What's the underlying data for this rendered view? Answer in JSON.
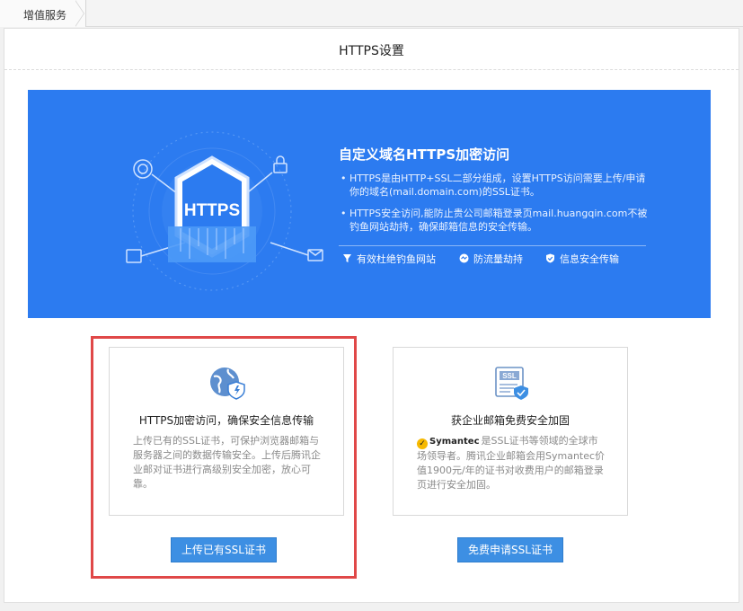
{
  "breadcrumb": {
    "tab_label": "增值服务"
  },
  "page": {
    "title": "HTTPS设置"
  },
  "banner": {
    "badge_text": "HTTPS",
    "title": "自定义域名HTTPS加密访问",
    "bullets": [
      "HTTPS是由HTTP+SSL二部分组成，设置HTTPS访问需要上传/申请你的域名(mail.domain.com)的SSL证书。",
      "HTTPS安全访问,能防止贵公司邮箱登录页mail.huangqin.com不被钓鱼网站劫持，确保邮箱信息的安全传输。"
    ],
    "features": [
      {
        "label": "有效杜绝钓鱼网站",
        "icon": "filter-icon"
      },
      {
        "label": "防流量劫持",
        "icon": "shield-flow-icon"
      },
      {
        "label": "信息安全传输",
        "icon": "shield-check-icon"
      }
    ]
  },
  "cards": {
    "upload": {
      "title": "HTTPS加密访问，确保安全信息传输",
      "description": "上传已有的SSL证书，可保护浏览器邮箱与服务器之间的数据传输安全。上传后腾讯企业邮对证书进行高级别安全加密，放心可靠。",
      "button_label": "上传已有SSL证书"
    },
    "apply": {
      "title": "获企业邮箱免费安全加固",
      "symantec_label": "Symantec",
      "description": "是SSL证书等领域的全球市场领导者。腾讯企业邮箱会用Symantec价值1900元/年的证书对收费用户的邮箱登录页进行安全加固。",
      "icon_text": "SSL",
      "button_label": "免费申请SSL证书"
    }
  },
  "colors": {
    "banner_blue": "#2c7bf0",
    "button_blue": "#3d8fe3",
    "highlight_red": "#e04848"
  }
}
